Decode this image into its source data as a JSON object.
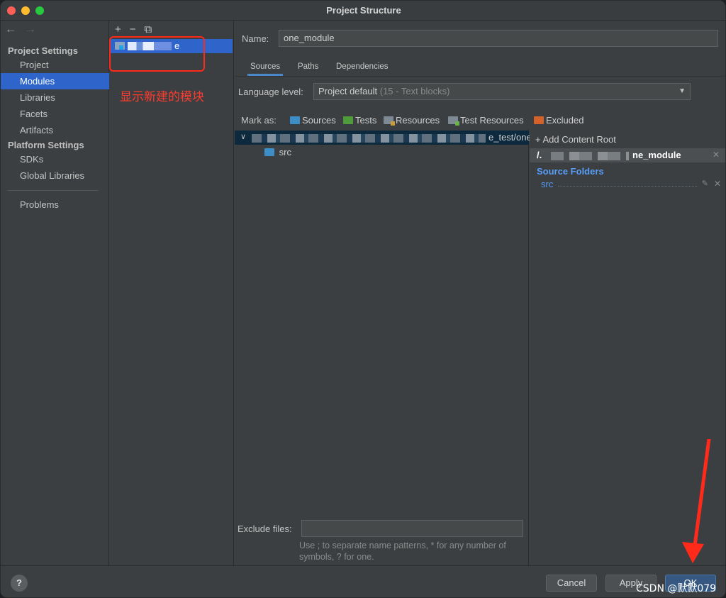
{
  "window": {
    "title": "Project Structure"
  },
  "nav": {
    "back_icon": "←",
    "forward_icon": "→",
    "project_settings_title": "Project Settings",
    "project_settings_items": [
      "Project",
      "Modules",
      "Libraries",
      "Facets",
      "Artifacts"
    ],
    "selected_item": "Modules",
    "platform_settings_title": "Platform Settings",
    "platform_settings_items": [
      "SDKs",
      "Global Libraries"
    ],
    "problems": "Problems"
  },
  "modules": {
    "add_icon": "+",
    "remove_icon": "−",
    "copy_icon": "⧉",
    "selected_module_visible_suffix": "e",
    "annotation": "显示新建的模块"
  },
  "main": {
    "name_label": "Name:",
    "name_value": "one_module",
    "tabs": [
      "Sources",
      "Paths",
      "Dependencies"
    ],
    "active_tab": "Sources",
    "language_level_label": "Language level:",
    "language_level_value": "Project default",
    "language_level_detail": "(15 - Text blocks)",
    "mark_as_label": "Mark as:",
    "mark_as": {
      "sources": "Sources",
      "tests": "Tests",
      "resources": "Resources",
      "test_resources": "Test Resources",
      "excluded": "Excluded"
    },
    "tree": {
      "root_path_visible": "ents/Code/...e_test/one_",
      "root_path_tail": "e_test/one_",
      "child": "src"
    },
    "content_root": {
      "add_label": "+ Add Content Root",
      "root_prefix": "/.",
      "root_suffix": "ne_module",
      "source_folders_title": "Source Folders",
      "source_folder": "src"
    },
    "exclude_files_label": "Exclude files:",
    "exclude_files_value": "",
    "hint": "Use ; to separate name patterns, * for any number of symbols, ? for one."
  },
  "footer": {
    "help": "?",
    "cancel": "Cancel",
    "apply": "Apply",
    "ok": "OK",
    "watermark": "CSDN @默默079"
  },
  "colors": {
    "selection": "#2f65ca",
    "annotation_red": "#ff2a1a",
    "link_blue": "#589df6"
  }
}
